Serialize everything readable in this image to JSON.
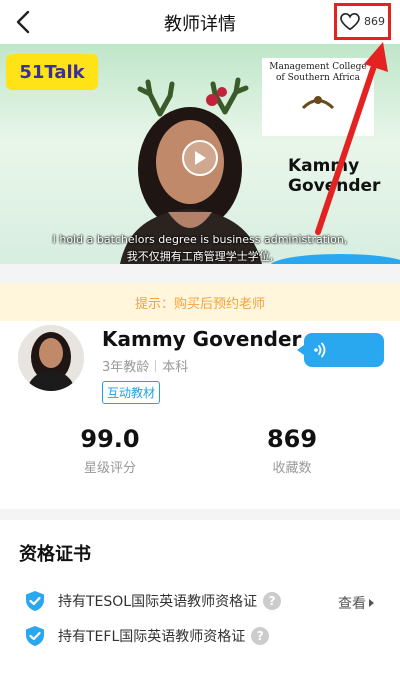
{
  "header": {
    "title": "教师详情",
    "favorite_count": "869"
  },
  "video": {
    "logo_text": "51Talk",
    "college_line1": "Management College",
    "college_line2": "of Southern Africa",
    "name_line1": "Kammy",
    "name_line2": "Govender",
    "subtitle_en": "I hold a batchelors degree is business administration,",
    "subtitle_zh": "我不仅拥有工商管理学士学位,"
  },
  "tip": "提示：购买后预约老师",
  "teacher": {
    "name": "Kammy Govender",
    "experience": "3年教龄",
    "degree": "本科",
    "tag": "互动教材"
  },
  "stats": [
    {
      "value": "99.0",
      "label": "星级评分"
    },
    {
      "value": "869",
      "label": "收藏数"
    }
  ],
  "certificates": {
    "title": "资格证书",
    "items": [
      {
        "label": "持有TESOL国际英语教师资格证"
      },
      {
        "label": "持有TEFL国际英语教师资格证"
      }
    ],
    "view_label": "查看"
  },
  "colors": {
    "accent_blue": "#2aa8ef",
    "annotation_red": "#e32222",
    "tip_text": "#f2a33c",
    "tip_background": "#fff6dc"
  },
  "icons": [
    "back-icon",
    "heart-icon",
    "play-icon",
    "sound-wave-icon",
    "shield-check-icon",
    "question-icon",
    "chevron-right-icon"
  ]
}
